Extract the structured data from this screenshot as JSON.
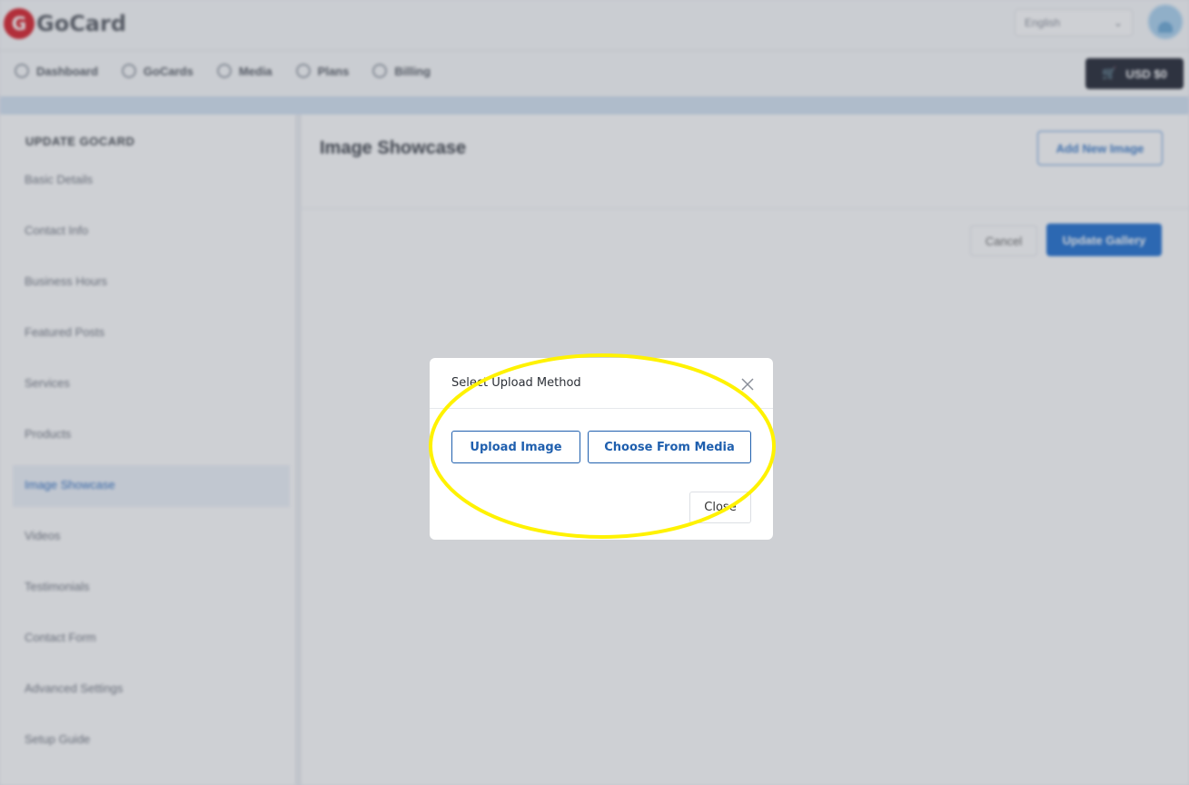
{
  "header": {
    "brand_mark": "G",
    "brand_name": "GoCard",
    "language": "English",
    "language_caret": "⌄"
  },
  "nav": {
    "items": [
      {
        "label": "Dashboard"
      },
      {
        "label": "GoCards"
      },
      {
        "label": "Media"
      },
      {
        "label": "Plans"
      },
      {
        "label": "Billing"
      }
    ],
    "cart_label": "USD $0",
    "cart_icon": "🛒"
  },
  "sidebar": {
    "title": "UPDATE GOCARD",
    "items": [
      {
        "label": "Basic Details"
      },
      {
        "label": "Contact Info"
      },
      {
        "label": "Business Hours"
      },
      {
        "label": "Featured Posts"
      },
      {
        "label": "Services"
      },
      {
        "label": "Products"
      },
      {
        "label": "Image Showcase"
      },
      {
        "label": "Videos"
      },
      {
        "label": "Testimonials"
      },
      {
        "label": "Contact Form"
      },
      {
        "label": "Advanced Settings"
      },
      {
        "label": "Setup Guide"
      }
    ],
    "active_index": 6
  },
  "main": {
    "title": "Image Showcase",
    "add_image_label": "Add New Image",
    "cancel_label": "Cancel",
    "update_label": "Update Gallery"
  },
  "modal": {
    "title": "Select Upload Method",
    "upload_image_label": "Upload Image",
    "choose_media_label": "Choose From Media",
    "close_label": "Close"
  },
  "colors": {
    "primary": "#1f5fae",
    "highlight_ring": "#fff200",
    "brand": "#d8202a"
  }
}
